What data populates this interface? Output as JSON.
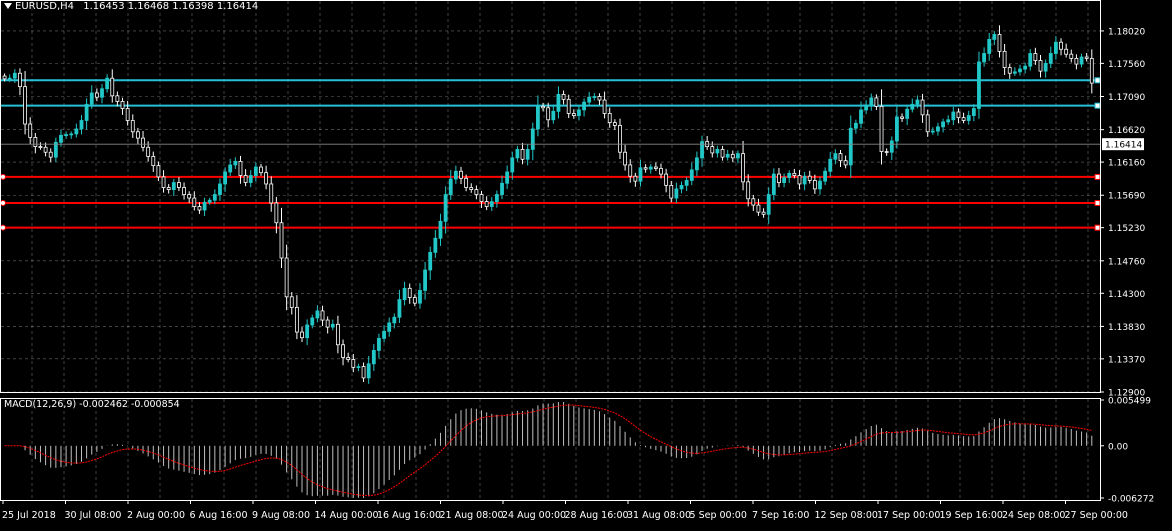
{
  "header": {
    "symbol": "EURUSD,H4",
    "open": "1.16453",
    "high": "1.16468",
    "low": "1.16398",
    "close": "1.16414"
  },
  "macd": {
    "label": "MACD(12,26,9) -0.002462 -0.000854",
    "scale_labels": [
      "0.005499",
      "0.00",
      "-0.006272"
    ],
    "range": [
      -0.006272,
      0.005499
    ]
  },
  "colors": {
    "background": "#000000",
    "grid": "#c0c0c0",
    "bull": "#22c8c8",
    "bear": "#ffffff",
    "resistance": "#27c0d6",
    "support": "#ff0000",
    "macd_hist": "#c0c0c0",
    "macd_signal": "#ff0000",
    "current_price_box": "#ffffff"
  },
  "chart_data": {
    "type": "candlestick",
    "title": "EURUSD,H4",
    "timeframe": "H4",
    "price_labels": [
      "1.18020",
      "1.17560",
      "1.17090",
      "1.16620",
      "1.16414",
      "1.16160",
      "1.15690",
      "1.15230",
      "1.14760",
      "1.14300",
      "1.13830",
      "1.13370",
      "1.12900"
    ],
    "current_price": "1.16414",
    "ylim": [
      1.129,
      1.1826
    ],
    "time_labels": [
      "25 Jul 2018",
      "30 Jul 08:00",
      "2 Aug 00:00",
      "6 Aug 16:00",
      "9 Aug 08:00",
      "14 Aug 00:00",
      "16 Aug 16:00",
      "21 Aug 08:00",
      "24 Aug 00:00",
      "28 Aug 16:00",
      "31 Aug 08:00",
      "5 Sep 00:00",
      "7 Sep 16:00",
      "12 Sep 08:00",
      "17 Sep 00:00",
      "19 Sep 16:00",
      "24 Sep 08:00",
      "27 Sep 00:00"
    ],
    "horizontal_levels": [
      {
        "price": 1.1732,
        "kind": "resistance"
      },
      {
        "price": 1.1696,
        "kind": "resistance"
      },
      {
        "price": 1.1595,
        "kind": "support"
      },
      {
        "price": 1.1558,
        "kind": "support"
      },
      {
        "price": 1.1523,
        "kind": "support"
      }
    ],
    "closes": [
      1.1734,
      1.1735,
      1.1742,
      1.1723,
      1.167,
      1.1651,
      1.1638,
      1.1637,
      1.163,
      1.1623,
      1.1644,
      1.1654,
      1.1655,
      1.1656,
      1.1663,
      1.1675,
      1.1698,
      1.1714,
      1.1708,
      1.172,
      1.1735,
      1.171,
      1.1702,
      1.1692,
      1.1675,
      1.1659,
      1.165,
      1.1637,
      1.1624,
      1.1611,
      1.1595,
      1.158,
      1.1577,
      1.1587,
      1.158,
      1.157,
      1.1565,
      1.1553,
      1.1548,
      1.1559,
      1.1562,
      1.157,
      1.1585,
      1.1602,
      1.1612,
      1.1617,
      1.1597,
      1.1587,
      1.1597,
      1.1609,
      1.1601,
      1.1585,
      1.1558,
      1.153,
      1.148,
      1.1425,
      1.141,
      1.1375,
      1.1367,
      1.1385,
      1.1395,
      1.1405,
      1.1392,
      1.1382,
      1.1386,
      1.1357,
      1.1339,
      1.1336,
      1.1325,
      1.1326,
      1.131,
      1.133,
      1.1349,
      1.1366,
      1.1376,
      1.1388,
      1.1396,
      1.1421,
      1.1437,
      1.1424,
      1.1416,
      1.1434,
      1.1463,
      1.1488,
      1.1508,
      1.1532,
      1.157,
      1.1592,
      1.1603,
      1.1593,
      1.158,
      1.1577,
      1.157,
      1.156,
      1.1553,
      1.156,
      1.157,
      1.1586,
      1.1602,
      1.1622,
      1.1634,
      1.162,
      1.1634,
      1.1663,
      1.1695,
      1.1693,
      1.1676,
      1.1688,
      1.1712,
      1.1705,
      1.1685,
      1.1682,
      1.169,
      1.1701,
      1.1708,
      1.1709,
      1.1704,
      1.1685,
      1.1672,
      1.1668,
      1.163,
      1.1612,
      1.1596,
      1.1589,
      1.1608,
      1.1606,
      1.1609,
      1.1607,
      1.1599,
      1.1583,
      1.1565,
      1.1578,
      1.1583,
      1.159,
      1.1605,
      1.1622,
      1.1645,
      1.1638,
      1.1629,
      1.1634,
      1.1623,
      1.1627,
      1.1622,
      1.1628,
      1.1588,
      1.1564,
      1.1555,
      1.1545,
      1.1542,
      1.157,
      1.1599,
      1.1587,
      1.1594,
      1.16,
      1.1597,
      1.1585,
      1.1596,
      1.159,
      1.1578,
      1.1589,
      1.1603,
      1.162,
      1.1628,
      1.1618,
      1.1612,
      1.1664,
      1.1671,
      1.169,
      1.1697,
      1.1707,
      1.1695,
      1.1631,
      1.163,
      1.1646,
      1.168,
      1.1678,
      1.1691,
      1.1698,
      1.1704,
      1.1683,
      1.1659,
      1.166,
      1.1666,
      1.1673,
      1.1676,
      1.1687,
      1.1679,
      1.1675,
      1.1682,
      1.1692,
      1.1758,
      1.177,
      1.179,
      1.1797,
      1.1773,
      1.175,
      1.1742,
      1.1744,
      1.1748,
      1.1752,
      1.177,
      1.176,
      1.1745,
      1.1756,
      1.177,
      1.1786,
      1.1776,
      1.1769,
      1.1763,
      1.1755,
      1.1765,
      1.1763,
      1.1728,
      1.169,
      1.1675,
      1.1664,
      1.1646,
      1.1641
    ]
  }
}
